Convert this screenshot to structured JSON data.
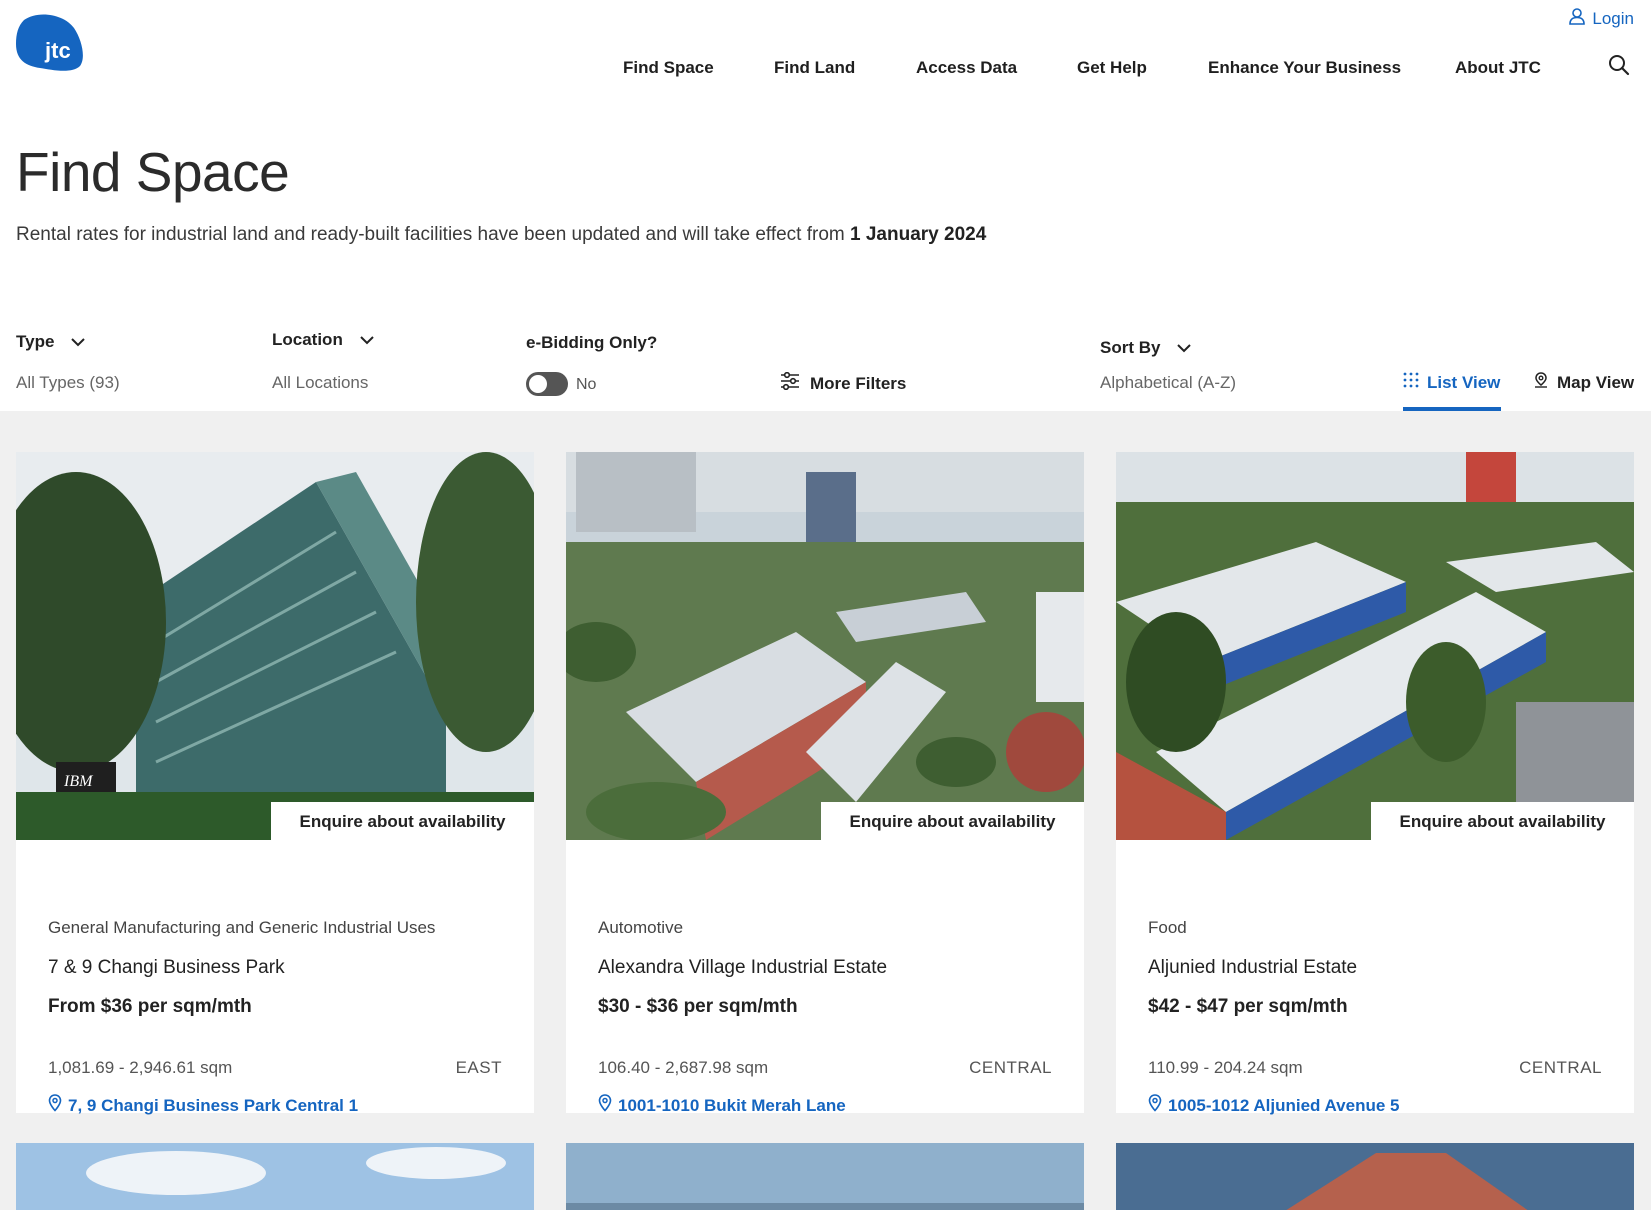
{
  "header": {
    "logo_text": "jtc",
    "login_label": "Login",
    "nav": [
      {
        "label": "Find Space"
      },
      {
        "label": "Find Land"
      },
      {
        "label": "Access Data"
      },
      {
        "label": "Get Help"
      },
      {
        "label": "Enhance Your Business"
      },
      {
        "label": "About JTC"
      }
    ]
  },
  "page": {
    "title": "Find Space",
    "notice_text": "Rental rates for industrial land and ready-built facilities have been updated and will take effect from ",
    "notice_date": "1 January 2024"
  },
  "filters": {
    "type_label": "Type",
    "type_value": "All Types (93)",
    "location_label": "Location",
    "location_value": "All Locations",
    "ebidding_label": "e-Bidding Only?",
    "ebidding_value": "No",
    "more_filters_label": "More Filters",
    "sort_label": "Sort By",
    "sort_value": "Alphabetical (A-Z)",
    "list_view_label": "List View",
    "map_view_label": "Map View"
  },
  "listings": [
    {
      "enquire_label": "Enquire about availability",
      "category": "General Manufacturing and Generic Industrial Uses",
      "name": "7 & 9 Changi Business Park",
      "price": "From $36 per sqm/mth",
      "area": "1,081.69 - 2,946.61 sqm",
      "region": "EAST",
      "address": "7, 9 Changi Business Park Central 1",
      "sign_text": "IBM"
    },
    {
      "enquire_label": "Enquire about availability",
      "category": "Automotive",
      "name": "Alexandra Village Industrial Estate",
      "price": "$30 - $36 per sqm/mth",
      "area": "106.40 - 2,687.98 sqm",
      "region": "CENTRAL",
      "address": "1001-1010 Bukit Merah Lane"
    },
    {
      "enquire_label": "Enquire about availability",
      "category": "Food",
      "name": "Aljunied Industrial Estate",
      "price": "$42 - $47 per sqm/mth",
      "area": "110.99 - 204.24 sqm",
      "region": "CENTRAL",
      "address": "1005-1012 Aljunied Avenue 5"
    }
  ],
  "colors": {
    "accent": "#1565c0",
    "logo_blue": "#1565c0",
    "results_bg": "#f0f0f0",
    "toggle_off": "#555555"
  },
  "icons": [
    "user-icon",
    "search-icon",
    "chevron-down-icon",
    "sliders-icon",
    "grid-dots-icon",
    "map-pin-icon",
    "location-pin-icon"
  ]
}
